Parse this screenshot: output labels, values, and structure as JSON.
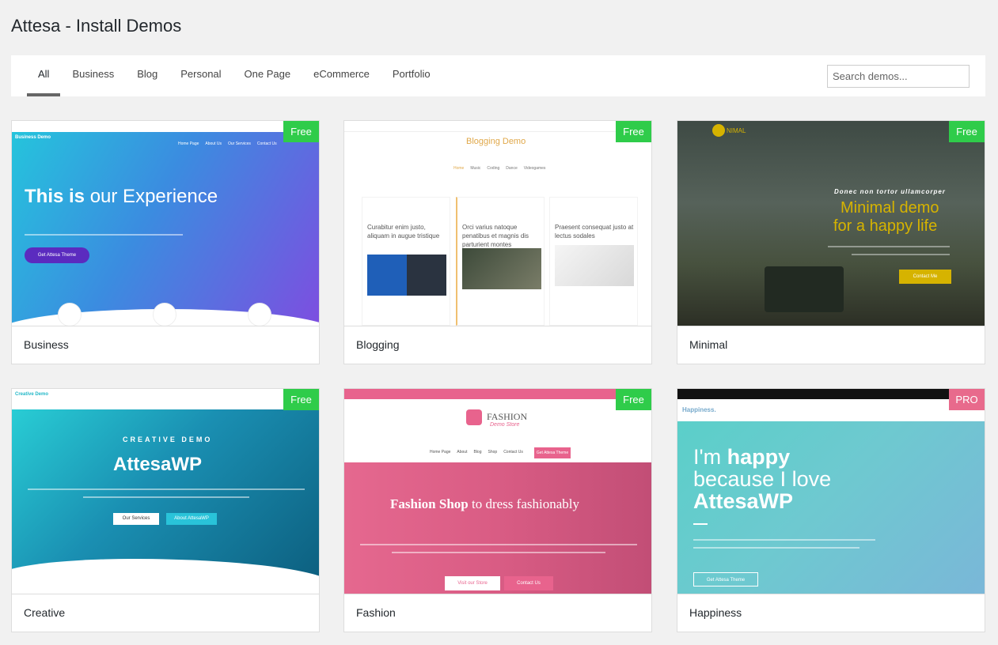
{
  "page_title": "Attesa - Install Demos",
  "tabs": [
    "All",
    "Business",
    "Blog",
    "Personal",
    "One Page",
    "eCommerce",
    "Portfolio"
  ],
  "active_tab": "All",
  "search": {
    "placeholder": "Search demos..."
  },
  "demos": [
    {
      "name": "Business",
      "badge": "Free"
    },
    {
      "name": "Blogging",
      "badge": "Free"
    },
    {
      "name": "Minimal",
      "badge": "Free"
    },
    {
      "name": "Creative",
      "badge": "Free"
    },
    {
      "name": "Fashion",
      "badge": "Free"
    },
    {
      "name": "Happiness",
      "badge": "PRO"
    }
  ],
  "previews": {
    "business": {
      "brand": "Business Demo",
      "heading_bold": "This is",
      "heading_rest": " our Experience",
      "cta": "Get Attesa Theme",
      "nav": [
        "Home Page",
        "About Us",
        "Our Services",
        "Contact Us"
      ]
    },
    "blogging": {
      "brand": "Blogging Demo",
      "nav": [
        "Home",
        "Music",
        "Coding",
        "Dance",
        "Videogames"
      ],
      "posts": [
        "Curabitur enim justo, aliquam in augue tristique",
        "Orci varius natoque penatibus et magnis dis parturient montes",
        "Praesent consequat justo at lectus sodales"
      ]
    },
    "minimal": {
      "brand": "NIMAL",
      "kicker": "Donec non tortor ullamcorper",
      "line1": "Minimal demo",
      "line2": "for a happy life",
      "cta": "Contact Me"
    },
    "creative": {
      "brand": "Creative Demo",
      "kicker": "CREATIVE DEMO",
      "title": "AttesaWP",
      "btn1": "Our Services",
      "btn2": "About AttesaWP"
    },
    "fashion": {
      "brand": "FASHION",
      "sub": "Demo Store",
      "heading_bold": "Fashion Shop",
      "heading_rest": " to dress fashionably",
      "btn1": "Visit our Store",
      "btn2": "Contact Us",
      "nav": [
        "Home Page",
        "About",
        "Blog",
        "Shop",
        "Contact Us"
      ],
      "nav_cta": "Get Attesa Theme"
    },
    "happiness": {
      "brand": "Happiness.",
      "line1": "I'm ",
      "line1b": "happy",
      "line2": "because I love",
      "line3": "AttesaWP",
      "cta": "Get Attesa Theme"
    }
  },
  "colors": {
    "free_badge": "#2fcc4a",
    "pro_badge": "#e86a8c",
    "minimal_accent": "#d6b300",
    "fashion_pink": "#e8638d"
  }
}
